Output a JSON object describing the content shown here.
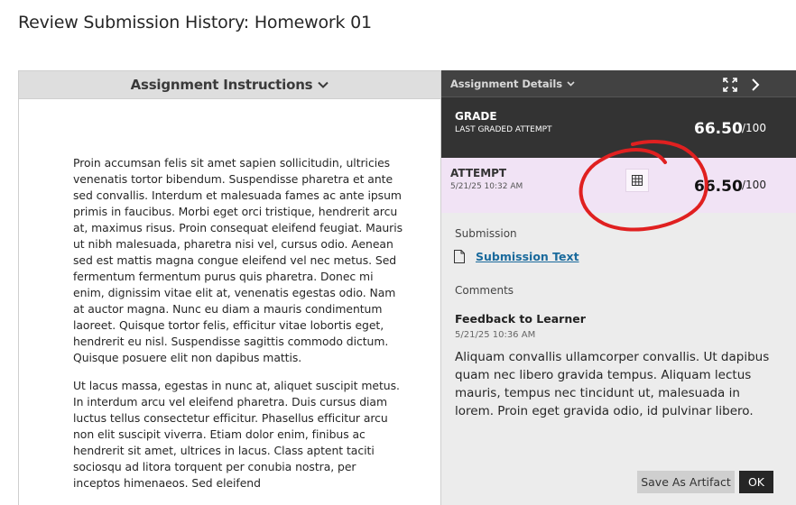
{
  "page": {
    "title": "Review Submission History: Homework 01"
  },
  "left_panel": {
    "header_label": "Assignment Instructions",
    "paragraphs": [
      "Proin accumsan felis sit amet sapien sollicitudin, ultricies venenatis tortor bibendum. Suspendisse pharetra et ante sed convallis. Interdum et malesuada fames ac ante ipsum primis in faucibus. Morbi eget orci tristique, hendrerit arcu at, maximus risus. Proin consequat eleifend feugiat. Mauris ut nibh malesuada, pharetra nisi vel, cursus odio. Aenean sed est mattis magna congue eleifend vel nec metus. Sed fermentum fermentum purus quis pharetra. Donec mi enim, dignissim vitae elit at, venenatis egestas odio. Nam at auctor magna. Nunc eu diam a mauris condimentum laoreet. Quisque tortor felis, efficitur vitae lobortis eget, hendrerit eu nisl. Suspendisse sagittis commodo dictum. Quisque posuere elit non dapibus mattis.",
      "Ut lacus massa, egestas in nunc at, aliquet suscipit metus. In interdum arcu vel eleifend pharetra. Duis cursus diam luctus tellus consectetur efficitur. Phasellus efficitur arcu non elit suscipit viverra. Etiam dolor enim, finibus ac hendrerit sit amet, ultrices in lacus. Class aptent taciti sociosqu ad litora torquent per conubia nostra, per inceptos himenaeos. Sed eleifend"
    ]
  },
  "details": {
    "header_label": "Assignment Details",
    "grade": {
      "label": "GRADE",
      "sublabel": "LAST GRADED ATTEMPT",
      "value": "66.50",
      "out_of": "/100"
    },
    "attempt": {
      "label": "ATTEMPT",
      "date": "5/21/25 10:32 AM",
      "value": "66.50",
      "out_of": "/100"
    },
    "submission": {
      "label": "Submission",
      "link_text": "Submission Text"
    },
    "comments": {
      "label": "Comments",
      "feedback_title": "Feedback to Learner",
      "feedback_date": "5/21/25 10:36 AM",
      "feedback_text": "Aliquam convallis ullamcorper convallis. Ut dapibus quam nec libero gravida tempus. Aliquam lectus mauris, tempus nec tincidunt ut, malesuada in lorem. Proin eget gravida odio, id pulvinar libero."
    },
    "buttons": {
      "save_artifact": "Save As Artifact",
      "ok": "OK"
    }
  },
  "colors": {
    "details_header": "#424242",
    "grade_row": "#333333",
    "attempt_row": "#f1e3f5",
    "link": "#1a6a9c",
    "annotation": "#e02020"
  },
  "icons": {
    "header_chevron": "chevron-down-icon",
    "expand": "expand-icon",
    "next": "chevron-right-icon",
    "rubric": "grid-icon",
    "document": "document-icon"
  }
}
